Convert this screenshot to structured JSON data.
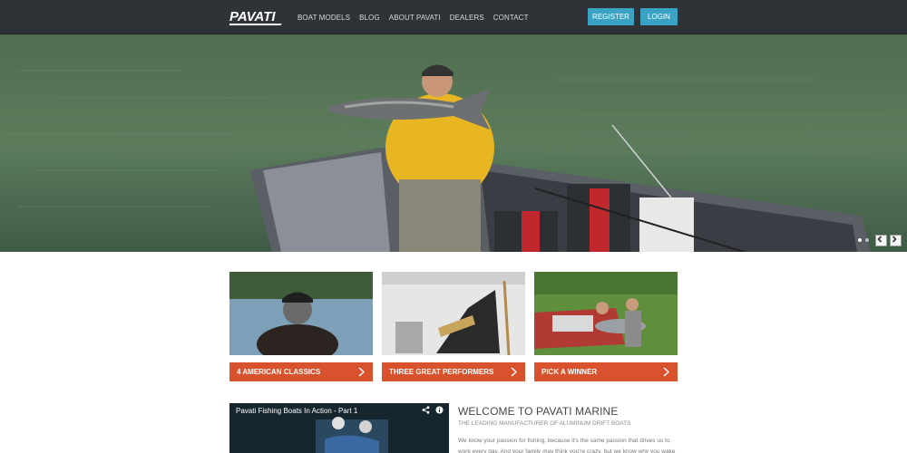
{
  "header": {
    "logo_text": "PAVATI",
    "nav": [
      "BOAT MODELS",
      "BLOG",
      "ABOUT PAVATI",
      "DEALERS",
      "CONTACT"
    ],
    "register_label": "REGISTER",
    "login_label": "LOGIN"
  },
  "hero": {
    "dots": 2,
    "active_dot": 0
  },
  "cards": [
    {
      "label": "4 AMERICAN CLASSICS"
    },
    {
      "label": "THREE GREAT PERFORMERS"
    },
    {
      "label": "PICK A WINNER"
    }
  ],
  "video": {
    "title": "Pavati Fishing Boats In Action - Part 1"
  },
  "welcome": {
    "heading": "WELCOME TO PAVATI MARINE",
    "subheading": "THE LEADING MANUFACTURER OF ALUMINUM DRIFT BOATS",
    "body": "We know your passion for fishing, because it's the same passion that drives us to work every day. And your family may think you're crazy, but we know why you wake up"
  },
  "colors": {
    "header_bg": "#2f3338",
    "button_blue": "#3aa3c4",
    "cta_orange": "#d8522d"
  }
}
